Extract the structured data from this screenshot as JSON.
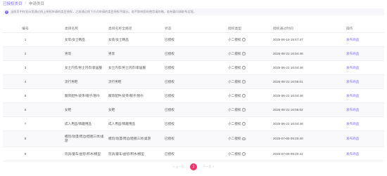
{
  "breadcrumb": {
    "active": "已授权类目",
    "separator": "/",
    "current": "申请类目"
  },
  "notice": {
    "icon": "info-icon",
    "text": "当前页中仅显示您通过线上授权申请的类目授权，之前通过线下方式申请的类目授权不展示。若不影响您的使用请忽略，若有疑问请联系运营。"
  },
  "table": {
    "headers": [
      "编号",
      "类目名称",
      "类目名称全路径",
      "状态",
      "授权类型",
      "授权通过时间",
      "操作"
    ],
    "rows": [
      {
        "num": "1",
        "name": "女装/女士精品",
        "path": "女装/女士精品",
        "status": "已授权",
        "type": "小二授权",
        "time": "2025-06-19 18:47:47",
        "action": "发布商品"
      },
      {
        "num": "2",
        "name": "男装",
        "path": "男装",
        "status": "已授权",
        "type": "小二授权",
        "time": "2025-06-22 16:04:48",
        "action": "发布商品"
      },
      {
        "num": "3",
        "name": "女士内衣/男士内衣/家居服",
        "path": "女士内衣/男士内衣/家居服",
        "status": "已授权",
        "type": "小二授权",
        "time": "2025-06-22 16:04:48",
        "action": "发布商品"
      },
      {
        "num": "4",
        "name": "流行男鞋",
        "path": "流行男鞋",
        "status": "已授权",
        "type": "小二授权",
        "time": "2025-06-22 16:05:01",
        "action": "发布商品"
      },
      {
        "num": "5",
        "name": "服饰配件/皮带/帽子/围巾",
        "path": "服饰配件/皮带/帽子/围巾",
        "status": "已授权",
        "type": "小二授权",
        "time": "2025-06-22 16:04:48",
        "action": "发布商品"
      },
      {
        "num": "6",
        "name": "女鞋",
        "path": "女鞋",
        "status": "已授权",
        "type": "小二授权",
        "time": "2025-06-22 16:05:02",
        "action": "发布商品"
      },
      {
        "num": "7",
        "name": "成人用品/情趣用品",
        "path": "成人用品/情趣用品",
        "status": "已授权",
        "type": "小二授权",
        "time": "2025-06-22 16:04:48",
        "action": "发布商品"
      },
      {
        "num": "8",
        "name": "模玩/动漫/周边/娃圈三坑/桌游",
        "path": "模玩/动漫/周边/娃圈三坑/桌游",
        "status": "已授权",
        "type": "小二授权",
        "time": "2025-07-09 09:20:40",
        "action": "发布商品"
      },
      {
        "num": "9",
        "name": "玩具/童车/益智/积木/模型",
        "path": "玩具/童车/益智/积木/模型",
        "status": "已授权",
        "type": "小二授权",
        "time": "2025-07-09 09:20:42",
        "action": "发布商品"
      }
    ]
  },
  "pager": {
    "prev": "< 上一页",
    "current": "1",
    "next": "下一页 >"
  },
  "colors": {
    "accent": "#7b6cf0",
    "pager_active": "#f0356b"
  }
}
